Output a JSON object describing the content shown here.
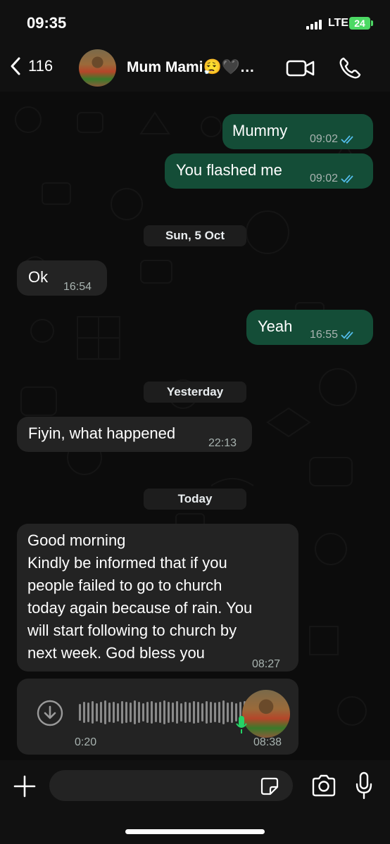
{
  "status": {
    "time": "09:35",
    "network": "LTE",
    "battery": "24"
  },
  "header": {
    "back_count": "116",
    "contact_name": "Mum Mami😮‍💨🖤…",
    "icons": [
      "chevron-left-icon",
      "video-call-icon",
      "phone-icon"
    ]
  },
  "messages": [
    {
      "type": "out",
      "text": "Mummy",
      "time": "09:02",
      "read": true
    },
    {
      "type": "out",
      "text": "You flashed me",
      "time": "09:02",
      "read": true
    },
    {
      "type": "date",
      "text": "Sun, 5 Oct"
    },
    {
      "type": "in",
      "text": "Ok",
      "time": "16:54"
    },
    {
      "type": "out",
      "text": "Yeah",
      "time": "16:55",
      "read": true
    },
    {
      "type": "date",
      "text": "Yesterday"
    },
    {
      "type": "in",
      "text": "Fiyin, what happened",
      "time": "22:13"
    },
    {
      "type": "date",
      "text": "Today"
    },
    {
      "type": "in",
      "lines": [
        "Good morning",
        "Kindly be informed that if you",
        "people failed to go to church",
        "today again because of rain. You",
        "will start following to church  by",
        "next week. God bless you"
      ],
      "time": "08:27"
    },
    {
      "type": "voice",
      "duration": "0:20",
      "time": "08:38"
    }
  ],
  "input": {
    "placeholder": ""
  },
  "colors": {
    "outgoing": "#144d37",
    "incoming": "#232323",
    "tick": "#53bdeb",
    "mic_green": "#25d366",
    "battery": "#4cd964"
  }
}
